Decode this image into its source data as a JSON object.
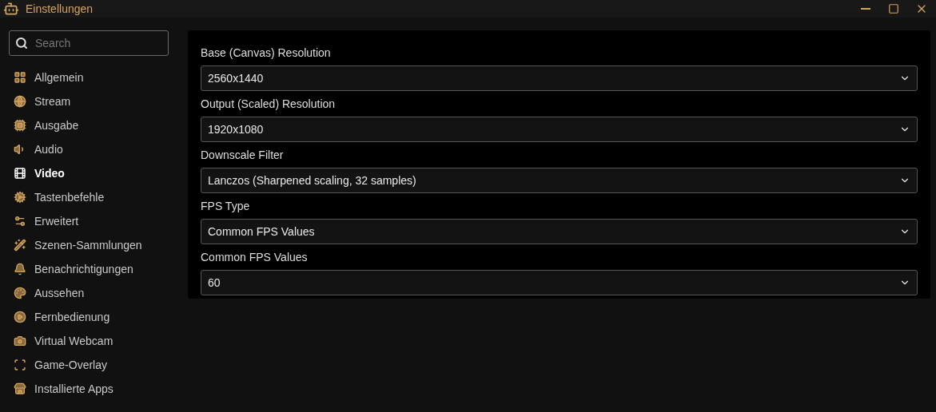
{
  "window": {
    "title": "Einstellungen"
  },
  "search": {
    "placeholder": "Search"
  },
  "sidebar": {
    "items": [
      {
        "label": "Allgemein",
        "selected": false
      },
      {
        "label": "Stream",
        "selected": false
      },
      {
        "label": "Ausgabe",
        "selected": false
      },
      {
        "label": "Audio",
        "selected": false
      },
      {
        "label": "Video",
        "selected": true
      },
      {
        "label": "Tastenbefehle",
        "selected": false
      },
      {
        "label": "Erweitert",
        "selected": false
      },
      {
        "label": "Szenen-Sammlungen",
        "selected": false
      },
      {
        "label": "Benachrichtigungen",
        "selected": false
      },
      {
        "label": "Aussehen",
        "selected": false
      },
      {
        "label": "Fernbedienung",
        "selected": false
      },
      {
        "label": "Virtual Webcam",
        "selected": false
      },
      {
        "label": "Game-Overlay",
        "selected": false
      },
      {
        "label": "Installierte Apps",
        "selected": false
      }
    ]
  },
  "fields": [
    {
      "label": "Base (Canvas) Resolution",
      "value": "2560x1440"
    },
    {
      "label": "Output (Scaled) Resolution",
      "value": "1920x1080"
    },
    {
      "label": "Downscale Filter",
      "value": "Lanczos (Sharpened scaling, 32 samples)"
    },
    {
      "label": "FPS Type",
      "value": "Common FPS Values"
    },
    {
      "label": "Common FPS Values",
      "value": "60"
    }
  ]
}
